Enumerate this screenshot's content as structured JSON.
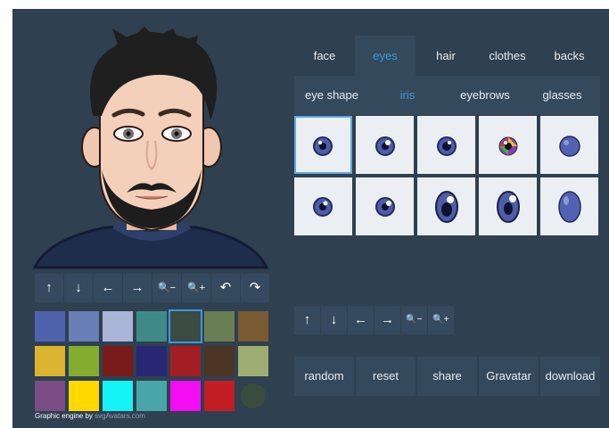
{
  "tabs": [
    {
      "label": "face"
    },
    {
      "label": "eyes",
      "active": true
    },
    {
      "label": "hair"
    },
    {
      "label": "clothes"
    },
    {
      "label": "backs"
    }
  ],
  "subtabs": [
    {
      "label": "eye shape"
    },
    {
      "label": "iris",
      "active": true
    },
    {
      "label": "eyebrows"
    },
    {
      "label": "glasses"
    }
  ],
  "iris_options": 10,
  "selected_iris_index": 0,
  "avatar_controls": [
    {
      "glyph": "↑",
      "name": "move-up-button"
    },
    {
      "glyph": "↓",
      "name": "move-down-button"
    },
    {
      "glyph": "←",
      "name": "move-left-button"
    },
    {
      "glyph": "→",
      "name": "move-right-button"
    },
    {
      "glyph": "🔍−",
      "name": "zoom-out-button"
    },
    {
      "glyph": "🔍+",
      "name": "zoom-in-button"
    },
    {
      "glyph": "↶",
      "name": "rotate-left-button"
    },
    {
      "glyph": "↷",
      "name": "rotate-right-button"
    }
  ],
  "part_controls": [
    {
      "glyph": "↑",
      "name": "part-move-up-button"
    },
    {
      "glyph": "↓",
      "name": "part-move-down-button"
    },
    {
      "glyph": "←",
      "name": "part-move-left-button"
    },
    {
      "glyph": "→",
      "name": "part-move-right-button"
    },
    {
      "glyph": "🔍−",
      "name": "part-zoom-out-button"
    },
    {
      "glyph": "🔍+",
      "name": "part-zoom-in-button"
    }
  ],
  "palette": [
    "#4f62ae",
    "#6a7fb7",
    "#aab3d8",
    "#3f8a88",
    "#3b4a43",
    "#6a7e53",
    "#7a5a32",
    "#dcb42f",
    "#84ad30",
    "#7a1b1b",
    "#2a2775",
    "#a31e24",
    "#4d3526",
    "#9ead72",
    "#7c4c87",
    "#ffd800",
    "#14f4f6",
    "#48a6a8",
    "#f40cf3",
    "#c21e23",
    "#3b4c3f"
  ],
  "selected_color_index": 4,
  "actions": [
    {
      "label": "random"
    },
    {
      "label": "reset"
    },
    {
      "label": "share"
    },
    {
      "label": "Gravatar"
    },
    {
      "label": "download"
    }
  ],
  "credit": {
    "prefix": "Graphic engine by ",
    "link": "svgAvatars.com"
  },
  "colors": {
    "background": "#2f4050",
    "panel": "#35495c",
    "accent": "#3a97e0",
    "cell": "#ebeff3"
  }
}
